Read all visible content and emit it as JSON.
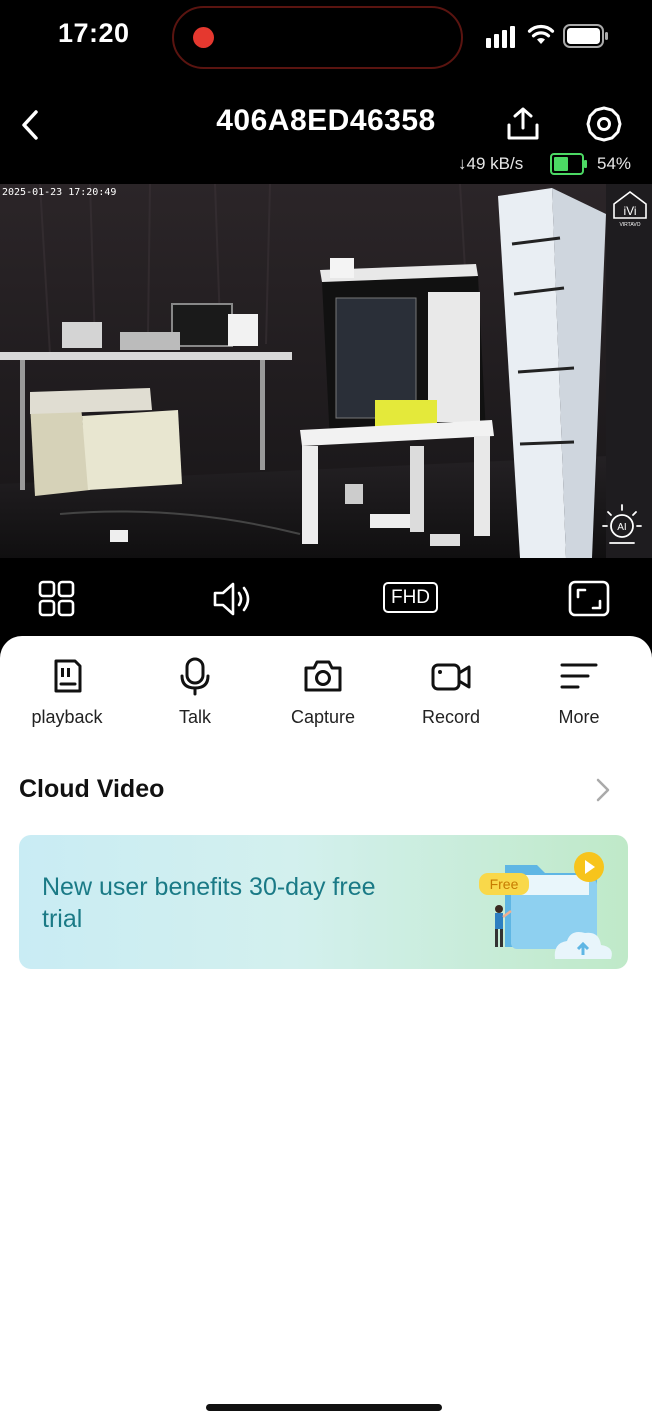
{
  "status_bar": {
    "time": "17:20"
  },
  "header": {
    "title": "406A8ED46358",
    "speed": "↓49 kB/s",
    "battery_percent": "54%",
    "battery_level": 0.54
  },
  "video": {
    "timestamp": "2025-01-23 17:20:49",
    "watermark": "VIRTAVO",
    "ai_badge": "AI"
  },
  "controls": {
    "quality_label": "FHD"
  },
  "actions": [
    {
      "label": "playback",
      "icon": "sd-card-icon"
    },
    {
      "label": "Talk",
      "icon": "microphone-icon"
    },
    {
      "label": "Capture",
      "icon": "camera-icon"
    },
    {
      "label": "Record",
      "icon": "video-camera-icon"
    },
    {
      "label": "More",
      "icon": "menu-lines-icon"
    }
  ],
  "cloud": {
    "title": "Cloud Video",
    "promo_text": "New user benefits 30-day free trial",
    "promo_badge": "Free"
  },
  "colors": {
    "accent_green": "#4cd964",
    "recording_red": "#e5382f",
    "promo_text": "#1a7a86"
  }
}
